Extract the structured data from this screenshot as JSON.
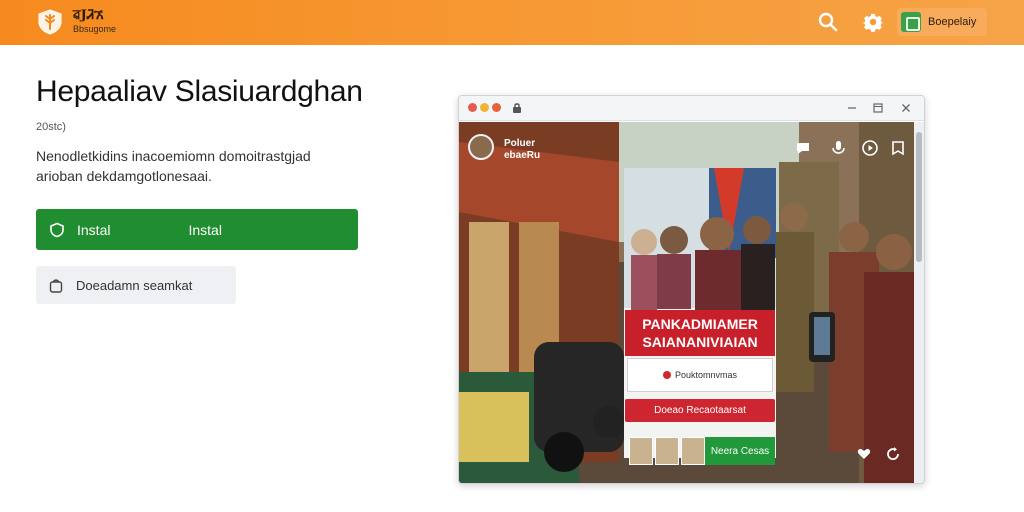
{
  "header": {
    "logo_icon": "wheat-shield-icon",
    "logo_title": "ৱJᏘኧ",
    "logo_subtitle": "Bbsugome",
    "search_icon": "search-icon",
    "settings_icon": "gear-icon",
    "action_label": "Boepelaiy",
    "colors": {
      "background": "#f68a1f",
      "action_bg": "#f8ac5b",
      "action_icon": "#3aa14a"
    }
  },
  "main": {
    "title": "Hepaaliav Slasiuardghan",
    "version": "20stc)",
    "description": "Nenodletkidins inacoemiomn domoitrastgjad arioban dekdamgotlonesaai.",
    "install_button": {
      "icon": "shield-icon",
      "label_left": "Instal",
      "label_right": "Instal",
      "color": "#1f8d30"
    },
    "secondary_button": {
      "icon": "bag-icon",
      "label": "Doeadamn seamkat"
    }
  },
  "preview": {
    "window_controls": [
      "minimize-icon",
      "maximize-icon",
      "close-icon"
    ],
    "overlay_top_text": [
      "Poluer",
      "ebaeRu"
    ],
    "overlay_icons": [
      "chat-icon",
      "mic-icon",
      "play-icon",
      "bookmark-icon"
    ],
    "card_title": "PANKADMIAMER SAIANANIVIAIAN",
    "card_field_text": "Pouktomnvmas",
    "card_button": "Doeao Recaotaarsat",
    "chip_label": "Neera Cesas",
    "corner_icons": [
      "heart-icon",
      "refresh-icon"
    ]
  }
}
